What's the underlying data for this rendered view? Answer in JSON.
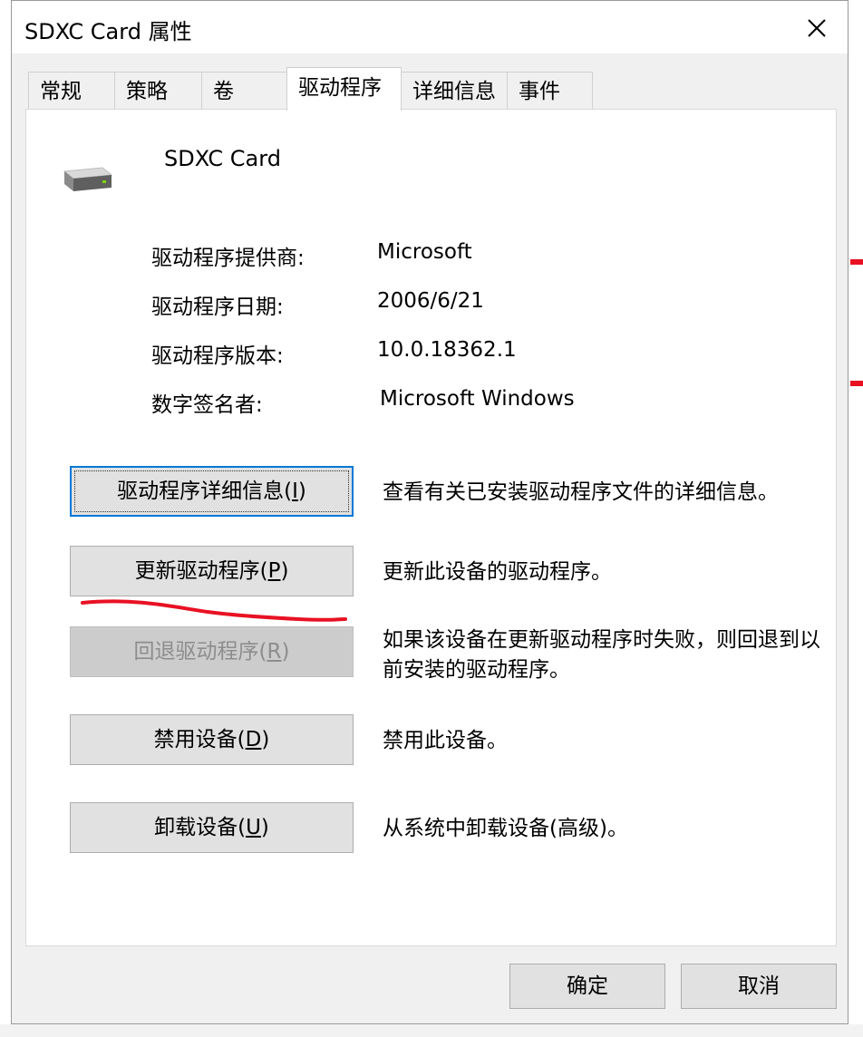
{
  "window": {
    "title": "SDXC Card 属性"
  },
  "tabs": [
    {
      "label": "常规"
    },
    {
      "label": "策略"
    },
    {
      "label": "卷"
    },
    {
      "label": "驱动程序"
    },
    {
      "label": "详细信息"
    },
    {
      "label": "事件"
    }
  ],
  "active_tab": "驱动程序",
  "device": {
    "name": "SDXC Card",
    "icon": "drive-icon"
  },
  "properties": [
    {
      "label": "驱动程序提供商:",
      "value": "Microsoft"
    },
    {
      "label": "驱动程序日期:",
      "value": "2006/6/21"
    },
    {
      "label": "驱动程序版本:",
      "value": "10.0.18362.1"
    },
    {
      "label": "数字签名者:",
      "value": "Microsoft Windows"
    }
  ],
  "actions": [
    {
      "label": "驱动程序详细信息(",
      "key": "I",
      "close": ")",
      "description": "查看有关已安装驱动程序文件的详细信息。",
      "enabled": true,
      "focused": true
    },
    {
      "label": "更新驱动程序(",
      "key": "P",
      "close": ")",
      "description": "更新此设备的驱动程序。",
      "enabled": true
    },
    {
      "label": "回退驱动程序(",
      "key": "R",
      "close": ")",
      "description": "如果该设备在更新驱动程序时失败，则回退到以前安装的驱动程序。",
      "enabled": false
    },
    {
      "label": "禁用设备(",
      "key": "D",
      "close": ")",
      "description": "禁用此设备。",
      "enabled": true
    },
    {
      "label": "卸载设备(",
      "key": "U",
      "close": ")",
      "description": "从系统中卸载设备(高级)。",
      "enabled": true
    }
  ],
  "footer": {
    "ok_label": "确定",
    "cancel_label": "取消"
  },
  "colors": {
    "focus": "#0078d7",
    "annotation": "#e81123"
  }
}
